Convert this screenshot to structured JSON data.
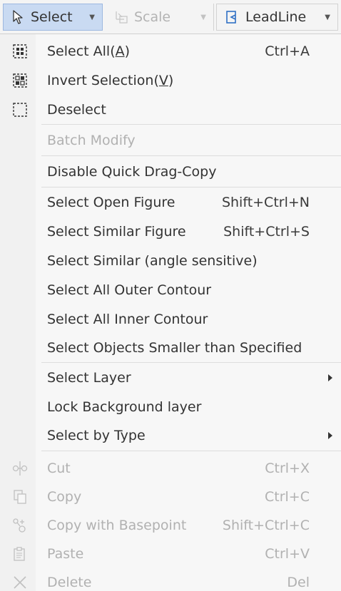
{
  "toolbar": {
    "select_label": "Select",
    "scale_label": "Scale",
    "leadline_label": "LeadLine"
  },
  "menu": {
    "select_all": {
      "label": "Select All(",
      "mnemonic": "A",
      "suffix": ")",
      "shortcut": "Ctrl+A"
    },
    "invert_selection": {
      "label": "Invert Selection(",
      "mnemonic": "V",
      "suffix": ")"
    },
    "deselect": {
      "label": "Deselect"
    },
    "batch_modify": {
      "label": "Batch Modify"
    },
    "disable_quick_drag_copy": {
      "label": "Disable Quick Drag-Copy"
    },
    "select_open_figure": {
      "label": "Select Open Figure",
      "shortcut": "Shift+Ctrl+N"
    },
    "select_similar_figure": {
      "label": "Select Similar Figure",
      "shortcut": "Shift+Ctrl+S"
    },
    "select_similar_angle": {
      "label": "Select Similar (angle sensitive)"
    },
    "select_all_outer_contour": {
      "label": "Select All Outer Contour"
    },
    "select_all_inner_contour": {
      "label": "Select All Inner Contour"
    },
    "select_objects_smaller": {
      "label": "Select Objects Smaller than Specified"
    },
    "select_layer": {
      "label": "Select Layer"
    },
    "lock_background_layer": {
      "label": "Lock Background layer"
    },
    "select_by_type": {
      "label": "Select by Type"
    },
    "cut": {
      "label": "Cut",
      "shortcut": "Ctrl+X"
    },
    "copy": {
      "label": "Copy",
      "shortcut": "Ctrl+C"
    },
    "copy_with_basepoint": {
      "label": "Copy with Basepoint",
      "shortcut": "Shift+Ctrl+C"
    },
    "paste": {
      "label": "Paste",
      "shortcut": "Ctrl+V"
    },
    "delete": {
      "label": "Delete",
      "shortcut": "Del"
    }
  },
  "colors": {
    "active_button_bg": "#c9daf2",
    "disabled_text": "#b1b1b1",
    "text": "#333333",
    "accent_blue": "#2f6fc4"
  },
  "icons": {
    "select_button": "cursor-arrow-icon",
    "scale_button": "scale-icon",
    "leadline_button": "leadline-icon",
    "select_all": "select-all-icon",
    "invert_selection": "invert-selection-icon",
    "deselect": "deselect-icon",
    "cut": "scissors-icon",
    "copy": "copy-icon",
    "copy_with_basepoint": "copy-basepoint-icon",
    "paste": "paste-icon",
    "delete": "delete-x-icon"
  }
}
